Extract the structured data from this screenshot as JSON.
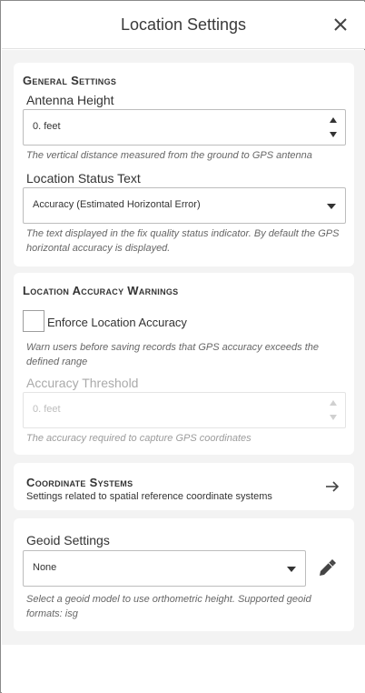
{
  "header": {
    "title": "Location Settings",
    "close_icon": "close-icon"
  },
  "general": {
    "title": "General Settings",
    "antenna_label": "Antenna Height",
    "antenna_value": "0. feet",
    "antenna_hint": "The vertical distance measured from the ground to GPS antenna",
    "status_label": "Location Status Text",
    "status_value": "Accuracy (Estimated Horizontal Error)",
    "status_hint": "The text displayed in the fix quality status indicator. By default the GPS horizontal accuracy is displayed."
  },
  "warnings": {
    "title": "Location Accuracy Warnings",
    "enforce_label": "Enforce Location Accuracy",
    "enforce_checked": false,
    "enforce_hint": "Warn users before saving records that GPS accuracy exceeds the defined range",
    "threshold_label": "Accuracy Threshold",
    "threshold_value": "0. feet",
    "threshold_hint": "The accuracy required to capture GPS coordinates"
  },
  "coordinates": {
    "title": "Coordinate Systems",
    "subtitle": "Settings related to spatial reference coordinate systems",
    "arrow_icon": "arrow-right-icon"
  },
  "geoid": {
    "label": "Geoid Settings",
    "value": "None",
    "hint": "Select a geoid model to use orthometric height. Supported geoid formats: isg",
    "edit_icon": "pencil-icon"
  }
}
